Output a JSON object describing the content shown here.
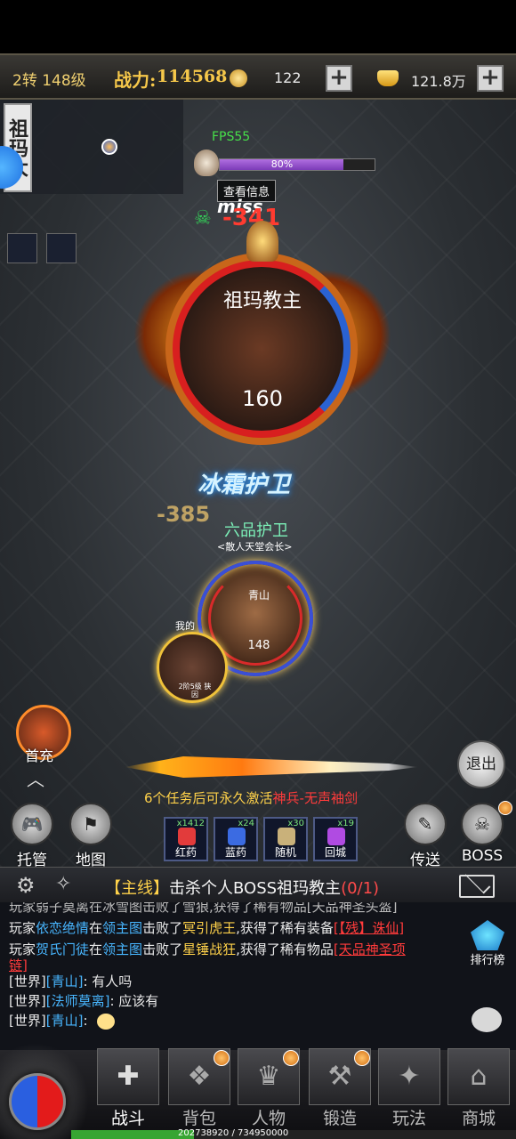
{
  "topbar": {
    "level": "2转 148级",
    "combat_label": "战力:",
    "combat_value": "114568",
    "coins": "122",
    "ingots": "121.8万"
  },
  "minimap": {
    "title": "祖玛大"
  },
  "battle": {
    "fps": "FPS55",
    "boss_hp_percent": 80,
    "boss_hp_text": "80%",
    "info_button": "查看信息",
    "miss_text": "miss",
    "damage_top": "-341",
    "boss_name": "祖玛教主",
    "boss_level": "160",
    "guard_title": "冰霜护卫",
    "damage_mid": "-385",
    "guard_rank": "六品护卫",
    "guard_sub": "<散人天堂会长>",
    "hero_name": "青山",
    "hero_level": "148",
    "pet_label": "我的",
    "pet_sub": "2阶5级 狭因"
  },
  "left_tools": {
    "first_charge": "首充"
  },
  "banner": {
    "prefix": "6个任务后可永久激活",
    "highlight": "神兵-无声袖剑"
  },
  "buttons": {
    "exit": "退出",
    "auto": "托管",
    "map": "地图",
    "teleport": "传送",
    "boss": "BOSS"
  },
  "potions": [
    {
      "label": "红药",
      "count": "x1412",
      "color": "#e23b3b"
    },
    {
      "label": "蓝药",
      "count": "x24",
      "color": "#3b6be2"
    },
    {
      "label": "随机",
      "count": "x30",
      "color": "#c9b17a"
    },
    {
      "label": "回城",
      "count": "x19",
      "color": "#b04be2"
    }
  ],
  "quest": {
    "tag": "【主线】",
    "text": "击杀个人BOSS祖玛教主",
    "progress": "(0/1)"
  },
  "chat": {
    "line0": "玩家弱子莫离在冰雪图击败了雪狼,获得了稀有物品[天品神圣头盔]",
    "line1": {
      "a": "玩家",
      "player": "依恋绝情",
      "b": "在",
      "map": "领主图",
      "c": "击败了",
      "boss": "冥引虎王",
      "d": ",获得了稀有装备",
      "item": "[【残】诛仙]"
    },
    "line2": {
      "a": "玩家",
      "player": "贺氏门徒",
      "b": "在",
      "map": "领主图",
      "c": "击败了",
      "boss": "星锤战狂",
      "d": ",获得了稀有物品",
      "item": "[天品神圣项"
    },
    "line2b": "链]",
    "line3": {
      "channel": "[世界]",
      "name": "[青山]",
      "msg": ": 有人吗"
    },
    "line4": {
      "channel": "[世界]",
      "name": "[法师莫离]",
      "msg": ": 应该有"
    },
    "line5": {
      "channel": "[世界]",
      "name": "[青山]",
      "msg": ":"
    },
    "rank_label": "排行榜"
  },
  "nav": [
    {
      "label": "战斗",
      "icon": "✚",
      "badge": false
    },
    {
      "label": "背包",
      "icon": "❖",
      "badge": true
    },
    {
      "label": "人物",
      "icon": "♛",
      "badge": true
    },
    {
      "label": "锻造",
      "icon": "⚒",
      "badge": true
    },
    {
      "label": "玩法",
      "icon": "✦",
      "badge": false
    },
    {
      "label": "商城",
      "icon": "⌂",
      "badge": false
    }
  ],
  "exp": {
    "text": "202738920 / 734950000",
    "ratio": 0.2759
  }
}
